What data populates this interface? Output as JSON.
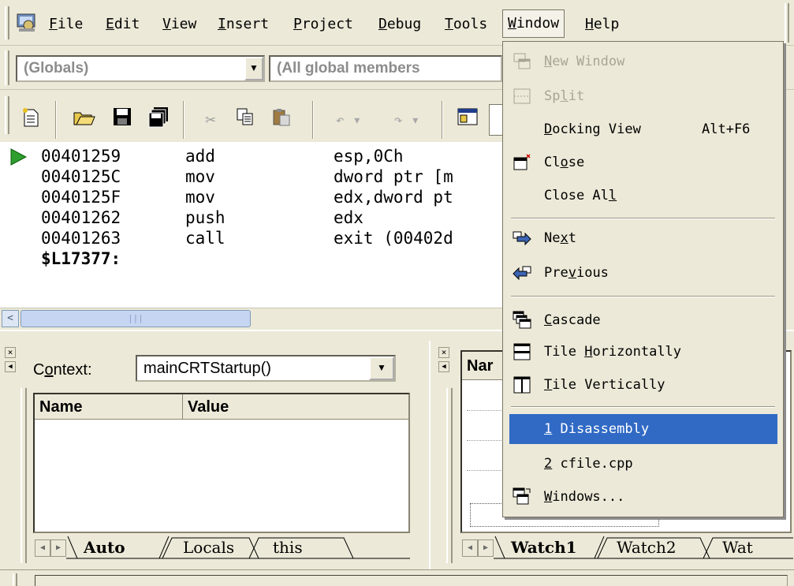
{
  "menubar": {
    "items": [
      {
        "pre": "",
        "ul": "F",
        "post": "ile"
      },
      {
        "pre": "",
        "ul": "E",
        "post": "dit"
      },
      {
        "pre": "",
        "ul": "V",
        "post": "iew"
      },
      {
        "pre": "",
        "ul": "I",
        "post": "nsert"
      },
      {
        "pre": "",
        "ul": "P",
        "post": "roject"
      },
      {
        "pre": "",
        "ul": "D",
        "post": "ebug"
      },
      {
        "pre": "",
        "ul": "T",
        "post": "ools"
      },
      {
        "pre": "",
        "ul": "W",
        "post": "indow"
      },
      {
        "pre": "",
        "ul": "H",
        "post": "elp"
      }
    ]
  },
  "combos": {
    "scope": "(Globals)",
    "members": "(All global members"
  },
  "code": {
    "rows": [
      {
        "addr": "00401259",
        "mn": "add",
        "op": "esp,0Ch"
      },
      {
        "addr": "0040125C",
        "mn": "mov",
        "op": "dword ptr [m"
      },
      {
        "addr": "0040125F",
        "mn": "mov",
        "op": "edx,dword pt"
      },
      {
        "addr": "00401262",
        "mn": "push",
        "op": "edx"
      },
      {
        "addr": "00401263",
        "mn": "call",
        "op": "exit (00402d"
      }
    ],
    "label": "$L17377:"
  },
  "variables": {
    "context_pre": "C",
    "context_ul": "o",
    "context_post": "ntext:",
    "context_value": "mainCRTStartup()",
    "col_name": "Name",
    "col_value": "Value",
    "tabs": [
      "Auto",
      "Locals",
      "this"
    ]
  },
  "watch": {
    "col_name": "Nar",
    "tabs": [
      "Watch1",
      "Watch2",
      "Wat"
    ]
  },
  "window_menu": {
    "new_window": {
      "ul": "N",
      "post": "ew Window"
    },
    "split": {
      "pre": "Sp",
      "ul": "l",
      "post": "it"
    },
    "docking": {
      "ul": "D",
      "post": "ocking View",
      "shortcut": "Alt+F6"
    },
    "close": {
      "pre": "Cl",
      "ul": "o",
      "post": "se"
    },
    "close_all": {
      "pre": "Close Al",
      "ul": "l",
      "post": ""
    },
    "next": {
      "pre": "Ne",
      "ul": "x",
      "post": "t"
    },
    "previous": {
      "pre": "Pre",
      "ul": "v",
      "post": "ious"
    },
    "cascade": {
      "ul": "C",
      "post": "ascade"
    },
    "tile_h": {
      "pre": "Tile ",
      "ul": "H",
      "post": "orizontally"
    },
    "tile_v": {
      "ul": "T",
      "post": "ile Vertically"
    },
    "win1": {
      "ul": "1",
      "post": " Disassembly"
    },
    "win2": {
      "ul": "2",
      "post": " cfile.cpp"
    },
    "windows": {
      "ul": "W",
      "post": "indows..."
    }
  },
  "colors": {
    "accent": "#316ac5",
    "play": "#2e9e2e"
  }
}
